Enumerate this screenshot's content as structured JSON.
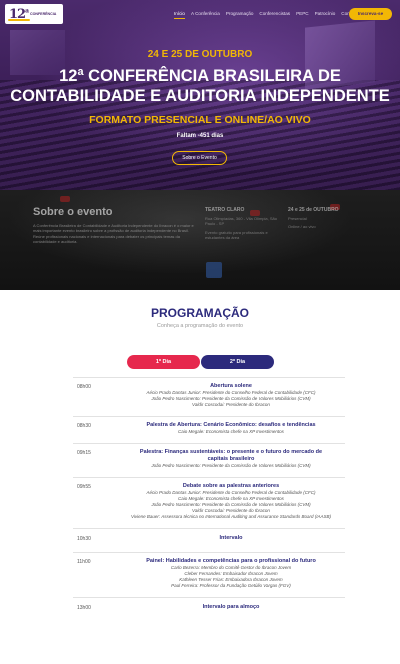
{
  "header": {
    "logo_number": "12",
    "logo_sup": "a",
    "logo_text": "CONFERÊNCIA",
    "nav": [
      "Início",
      "A Conferência",
      "Programação",
      "Conferencistas",
      "PEPC",
      "Patrocínio",
      "Contato"
    ],
    "nav_active": 0,
    "cta_label": "Inscreva-se"
  },
  "hero": {
    "date": "24 E 25 DE OUTUBRO",
    "title_line1": "12ª CONFERÊNCIA BRASILEIRA DE",
    "title_line2": "CONTABILIDADE E AUDITORIA INDEPENDENTE",
    "format": "FORMATO PRESENCIAL E ONLINE/AO VIVO",
    "countdown": "Faltam -451 dias",
    "about_button": "Sobre o Evento"
  },
  "about": {
    "title": "Sobre o evento",
    "body": "A Conferência Brasileira de Contabilidade e Auditoria Independente do Ibracon é o maior e mais importante evento brasileiro sobre a profissão de auditoria independente no Brasil. Reúne profissionais nacionais e internacionais para debater os principais temas da contabilidade e auditoria.",
    "col2_title": "TEATRO CLARO",
    "col2_text": "Rua Olimpíadas, 360 - Vila Olímpia, São Paulo - SP",
    "col2_text2": "Evento gratuito para profissionais e estudantes da área",
    "col3_title": "24 e 25 de OUTUBRO",
    "col3_text": "Presencial",
    "col3_text2": "Online / ao vivo"
  },
  "programacao": {
    "title": "PROGRAMAÇÃO",
    "subtitle": "Conheça a programação do evento",
    "day_tabs": [
      "1º Dia",
      "2º Dia"
    ],
    "active_day": 0,
    "rows": [
      {
        "time": "08h00",
        "title": "Abertura solene",
        "speakers": [
          "Aécio Prado Dantas Junior: Presidente do Conselho Federal de Contabilidade (CFC)",
          "João Pedro Nascimento: Presidente da Comissão de Valores Mobiliários (CVM)",
          "Valdir Coscodai: Presidente do Ibracon"
        ]
      },
      {
        "time": "08h30",
        "title": "Palestra de Abertura: Cenário Econômico: desafios e tendências",
        "speakers": [
          "Caio Megale: Economista chefe na XP Investimentos"
        ]
      },
      {
        "time": "09h15",
        "title": "Palestra: Finanças sustentáveis: o presente e o futuro do mercado de capitais brasileiro",
        "speakers": [
          "João Pedro Nascimento: Presidente da Comissão de Valores Mobiliários (CVM)"
        ]
      },
      {
        "time": "09h55",
        "title": "Debate sobre as palestras anteriores",
        "speakers": [
          "Aécio Prado Dantas Junior: Presidente do Conselho Federal de Contabilidade (CFC)",
          "Caio Megale: Economista chefe na XP Investimentos",
          "João Pedro Nascimento: Presidente da Comissão de Valores Mobiliários (CVM)",
          "Valdir Coscodai: Presidente do Ibracon",
          "Viviene Bauer: Assessora técnica no International Auditing and Assurance Standards Board (IAASB)"
        ]
      },
      {
        "time": "10h30",
        "title": "Intervalo",
        "speakers": []
      },
      {
        "time": "11h00",
        "title": "Painel: Habilidades e competências para o profissional do futuro",
        "speakers": [
          "Carlo Bezerra: Membro do Comitê Gestor do Ibracon Jovem",
          "Cleber Fernandes: Embaixador Ibracon Jovem",
          "Kathleen Tesser Frias: Embaixadora Ibracon Jovem",
          "Paul Ferreira: Professor da Fundação Getúlio Vargas (FGV)"
        ]
      },
      {
        "time": "13h00",
        "title": "Intervalo para almoço",
        "speakers": []
      }
    ]
  }
}
